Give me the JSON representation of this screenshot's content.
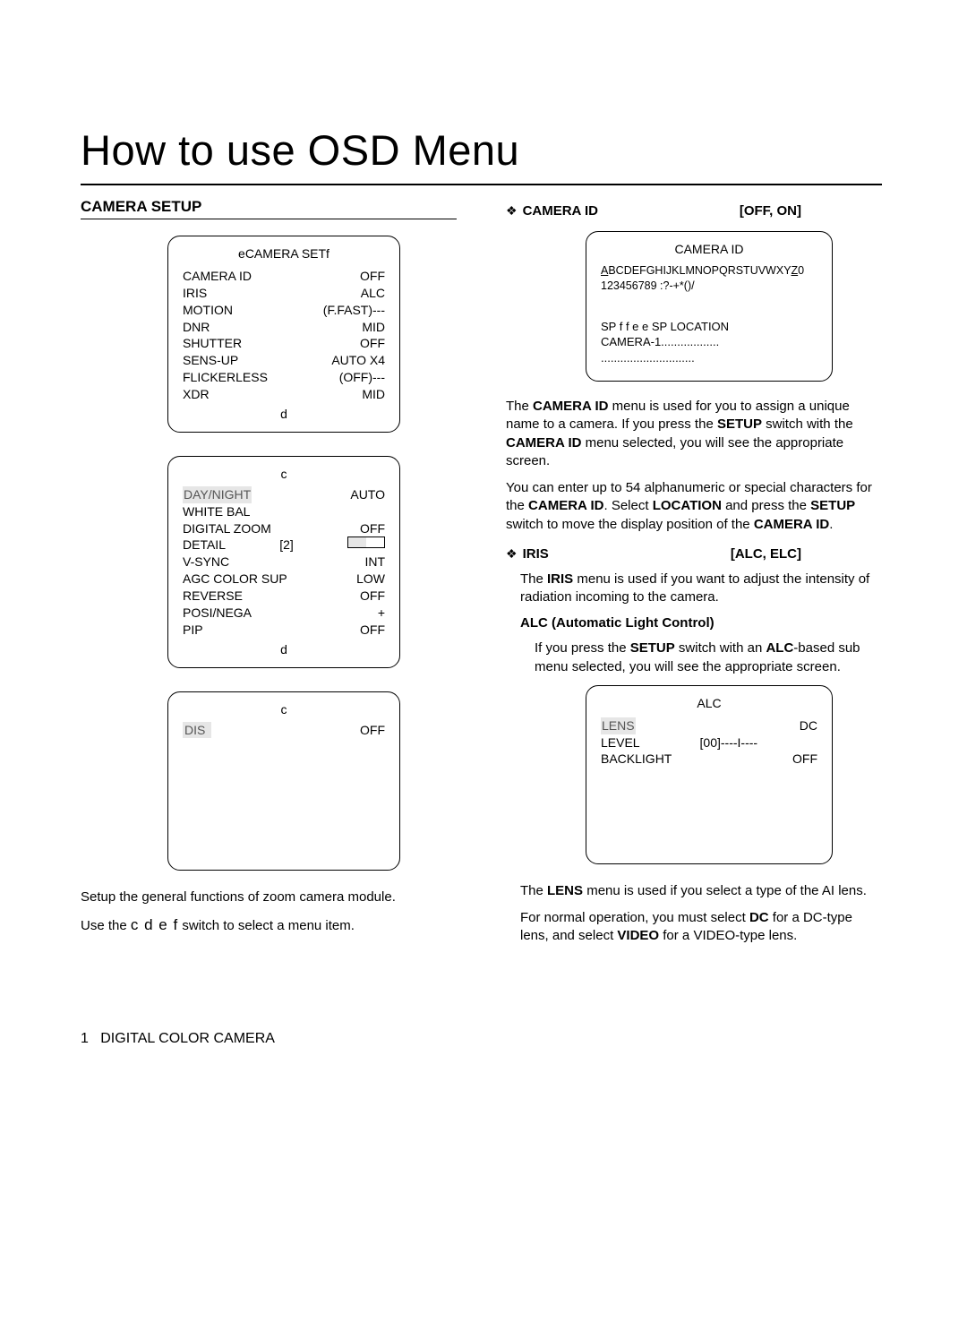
{
  "title": "How to use OSD Menu",
  "left": {
    "section": "CAMERA SETUP",
    "panel1": {
      "title": "eCAMERA SETf",
      "rows": [
        {
          "l": "CAMERA ID",
          "r": "OFF"
        },
        {
          "l": "IRIS",
          "r": "ALC"
        },
        {
          "l": "MOTION",
          "r": "(F.FAST)---"
        },
        {
          "l": "DNR",
          "r": "MID"
        },
        {
          "l": "SHUTTER",
          "r": "OFF"
        },
        {
          "l": "SENS-UP",
          "r": "AUTO X4"
        },
        {
          "l": "FLICKERLESS",
          "r": "(OFF)---"
        },
        {
          "l": "XDR",
          "r": "MID"
        }
      ],
      "foot": "d"
    },
    "panel2": {
      "top": "c",
      "rows": [
        {
          "l": "DAY/NIGHT",
          "r": "AUTO",
          "hl": true
        },
        {
          "l": "WHITE BAL",
          "r": ""
        },
        {
          "l": "DIGITAL ZOOM",
          "r": "OFF"
        },
        {
          "l": "DETAIL",
          "m": "[2]",
          "r": "BAR"
        },
        {
          "l": "V-SYNC",
          "r": "INT"
        },
        {
          "l": "AGC COLOR SUP",
          "r": "LOW"
        },
        {
          "l": "REVERSE",
          "r": "OFF"
        },
        {
          "l": "POSI/NEGA",
          "r": "+"
        },
        {
          "l": "PIP",
          "r": "OFF"
        }
      ],
      "foot": "d"
    },
    "panel3": {
      "top": "c",
      "rows": [
        {
          "l": "DIS",
          "r": "OFF",
          "hl_l": true
        }
      ]
    },
    "caption1": "Setup the general functions of zoom camera module.",
    "caption2a": "Use the ",
    "caption2b": "c d e f",
    "caption2c": " switch to select a menu item."
  },
  "right": {
    "bullet1": {
      "name": "CAMERA ID",
      "options": "[OFF, ON]"
    },
    "camera_id_panel": {
      "title": "CAMERA ID",
      "line1a": "A",
      "line1b": "BCDEFGHIJKLMNOPQRSTUVWXY",
      "line1c": "Z",
      "line1d": "0",
      "line2": "123456789 :?-+*()/",
      "line4": "SP f f e e  SP LOCATION",
      "line5": "CAMERA-1..................",
      "line6": "............................."
    },
    "para1a": "The ",
    "para1b": "CAMERA ID",
    "para1c": " menu is used for you to assign a unique name to a camera. If you press the ",
    "para1d": "SETUP",
    "para1e": " switch with the ",
    "para1f": "CAMERA ID",
    "para1g": " menu selected, you will see the appropriate screen.",
    "para2a": "You can enter up to 54 alphanumeric or special characters for the ",
    "para2b": "CAMERA ID",
    "para2c": ". Select ",
    "para2d": "LOCATION",
    "para2e": " and press the ",
    "para2f": "SETUP",
    "para2g": " switch to move the display position of the ",
    "para2h": "CAMERA ID",
    "para2i": ".",
    "bullet2": {
      "name": "IRIS",
      "options": "[ALC, ELC]"
    },
    "para3a": "The ",
    "para3b": "IRIS",
    "para3c": " menu is used if you want to adjust the intensity of radiation incoming to the camera.",
    "alc_head": "ALC (Automatic Light Control)",
    "para4a": "If you press the ",
    "para4b": "SETUP",
    "para4c": " switch with an ",
    "para4d": "ALC",
    "para4e": "-based sub menu selected, you will see the appropriate screen.",
    "alc_panel": {
      "title": "ALC",
      "rows": [
        {
          "l": "LENS",
          "r": "DC",
          "hl": true
        },
        {
          "l": "LEVEL",
          "m": "[00]----I----"
        },
        {
          "l": "BACKLIGHT",
          "r": "OFF"
        }
      ]
    },
    "para5a": "The ",
    "para5b": "LENS",
    "para5c": " menu is used if you select a type of the AI lens.",
    "para6a": "For normal operation, you must select ",
    "para6b": "DC",
    "para6c": " for a DC-type lens, and select ",
    "para6d": "VIDEO",
    "para6e": " for a VIDEO-type lens."
  },
  "footer": {
    "page": "1",
    "label": "DIGITAL COLOR CAMERA"
  }
}
